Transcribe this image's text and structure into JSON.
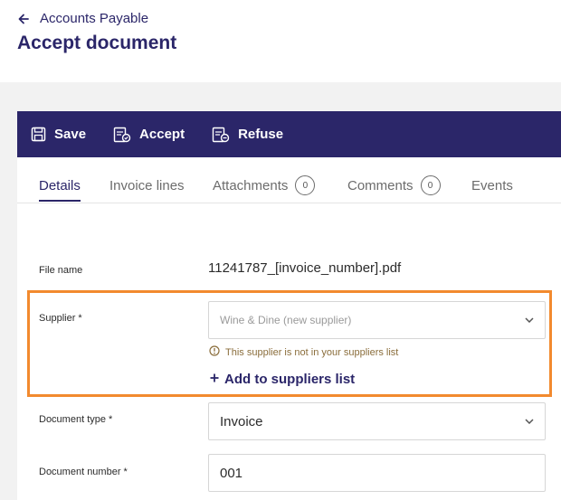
{
  "header": {
    "back_label": "Accounts Payable",
    "title": "Accept document"
  },
  "toolbar": {
    "save_label": "Save",
    "accept_label": "Accept",
    "refuse_label": "Refuse"
  },
  "tabs": [
    {
      "label": "Details",
      "active": true
    },
    {
      "label": "Invoice lines"
    },
    {
      "label": "Attachments",
      "count": "0"
    },
    {
      "label": "Comments",
      "count": "0"
    },
    {
      "label": "Events"
    }
  ],
  "form": {
    "file_name": {
      "label": "File name",
      "value": "11241787_[invoice_number].pdf"
    },
    "supplier": {
      "label": "Supplier *",
      "value": "Wine & Dine (new supplier)",
      "warning": "This supplier is not in your suppliers list",
      "add_label": "Add to suppliers list"
    },
    "document_type": {
      "label": "Document type *",
      "value": "Invoice"
    },
    "document_number": {
      "label": "Document number *",
      "value": "001"
    }
  },
  "colors": {
    "brand": "#2b2669",
    "highlight": "#f28a2e",
    "warning": "#8a6d3b"
  }
}
